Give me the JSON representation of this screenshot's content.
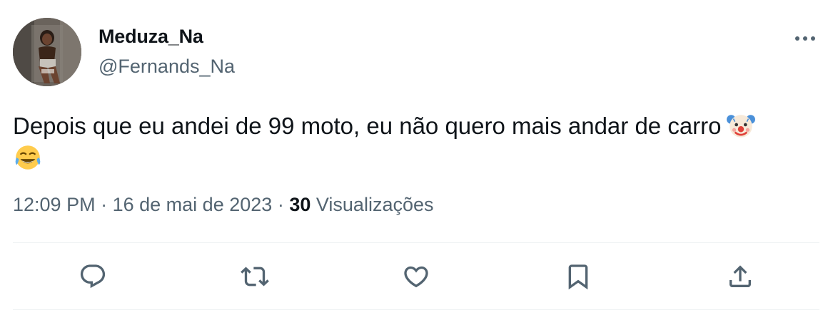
{
  "author": {
    "display_name": "Meduza_Na",
    "handle": "@Fernands_Na"
  },
  "tweet": {
    "text": "Depois que eu andei de 99 moto, eu não quero mais andar de carro",
    "emojis": [
      "clown-face-emoji",
      "face-with-tears-of-joy-emoji"
    ]
  },
  "meta": {
    "time": "12:09 PM",
    "separator": "·",
    "date": "16 de mai de 2023",
    "views_count": "30",
    "views_label": "Visualizações"
  },
  "icons": {
    "more": "more-dots-icon",
    "reply": "reply-icon",
    "retweet": "retweet-icon",
    "like": "like-icon",
    "bookmark": "bookmark-icon",
    "share": "share-icon"
  },
  "colors": {
    "text_primary": "#0f1419",
    "text_secondary": "#536471",
    "divider": "#eff3f4"
  }
}
